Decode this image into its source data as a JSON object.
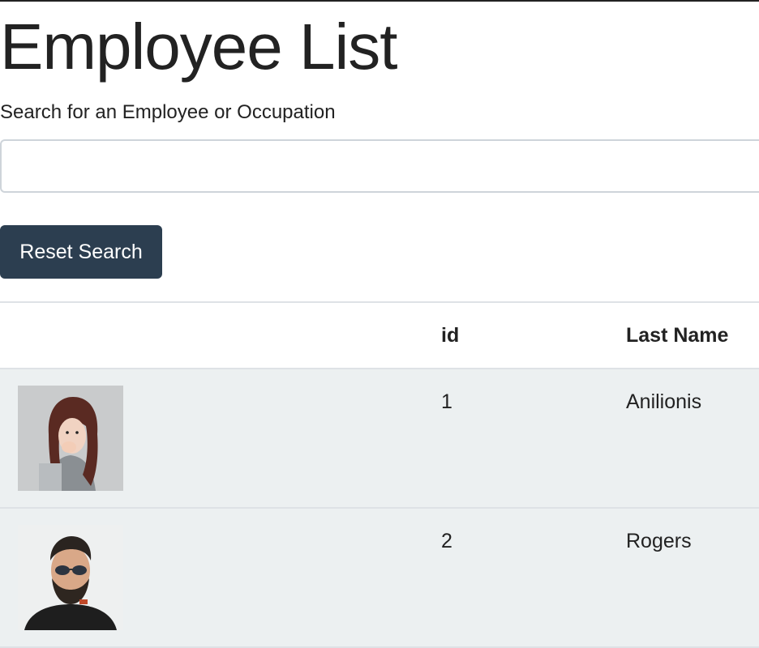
{
  "header": {
    "title": "Employee List"
  },
  "search": {
    "label": "Search for an Employee or Occupation",
    "value": "",
    "placeholder": ""
  },
  "reset_button": {
    "label": "Reset Search"
  },
  "table": {
    "columns": [
      "",
      "id",
      "Last Name"
    ],
    "rows": [
      {
        "avatar": "employee-photo-woman",
        "id": "1",
        "last_name": "Anilionis"
      },
      {
        "avatar": "employee-photo-man",
        "id": "2",
        "last_name": "Rogers"
      }
    ]
  },
  "colors": {
    "button_bg": "#2c3e50",
    "row_bg": "#ecf0f1",
    "border": "#dee2e6"
  }
}
